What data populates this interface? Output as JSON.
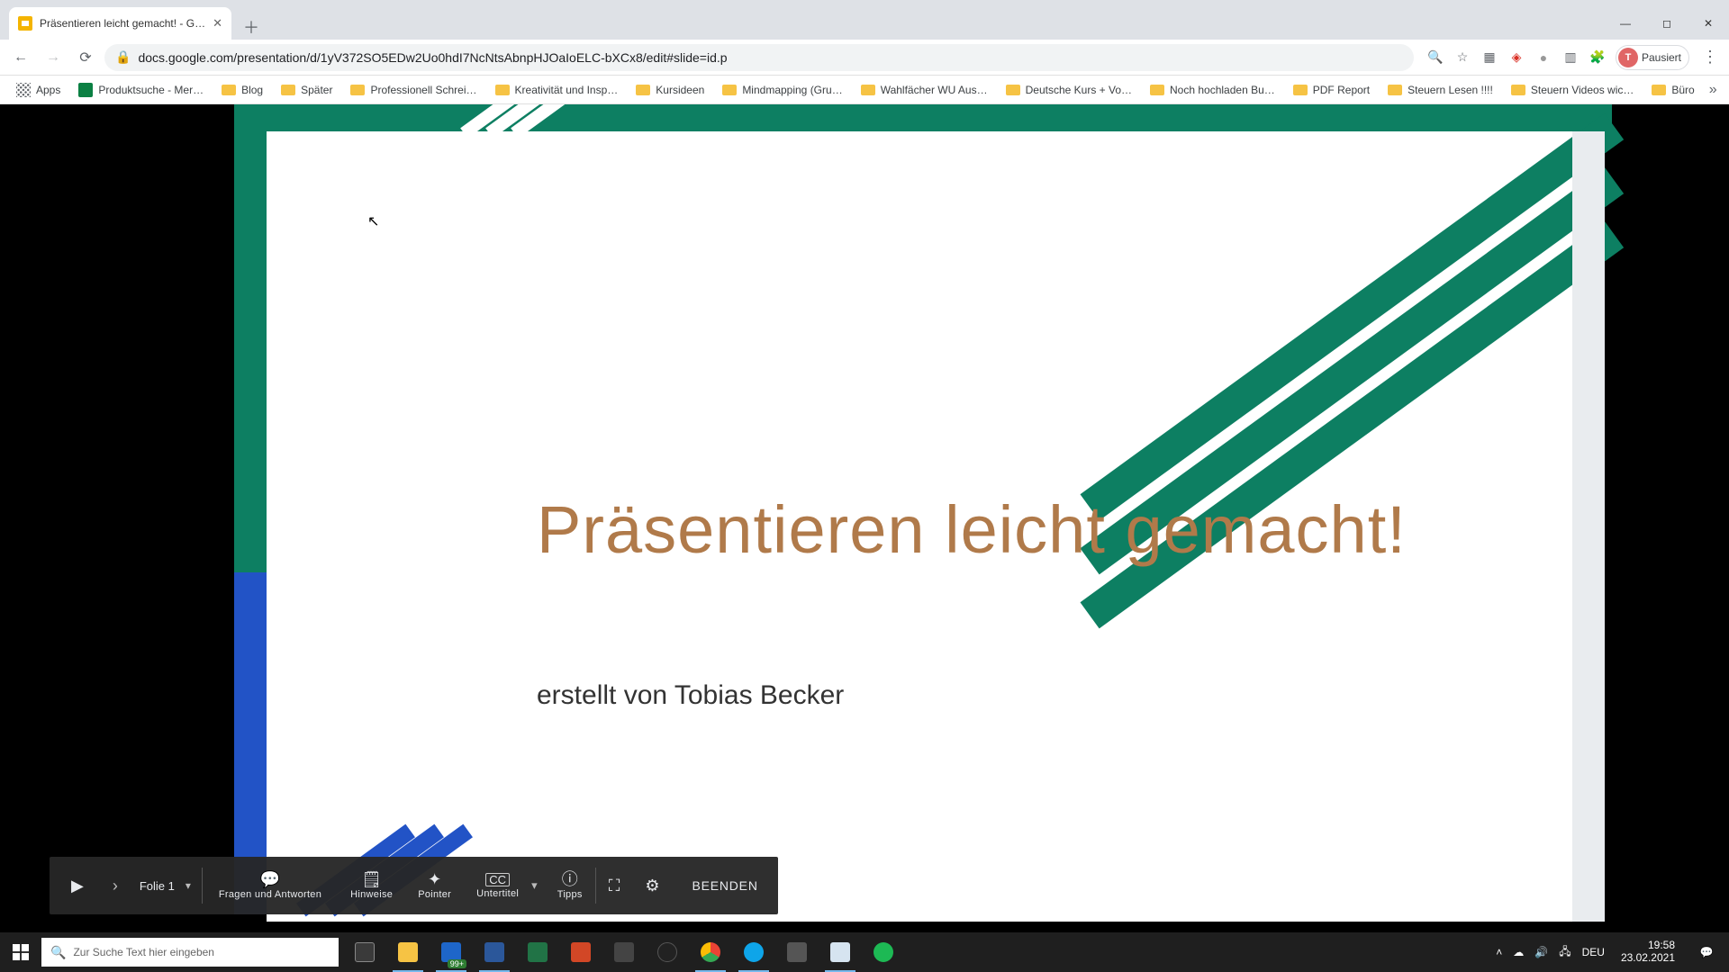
{
  "browser": {
    "tab_title": "Präsentieren leicht gemacht! - G…",
    "url": "docs.google.com/presentation/d/1yV372SO5EDw2Uo0hdI7NcNtsAbnpHJOaIoELC-bXCx8/edit#slide=id.p",
    "profile_state": "Pausiert",
    "profile_initial": "T",
    "apps_label": "Apps",
    "bookmarks": [
      {
        "label": "Produktsuche - Mer…",
        "icon": "img"
      },
      {
        "label": "Blog",
        "icon": "folder"
      },
      {
        "label": "Später",
        "icon": "folder"
      },
      {
        "label": "Professionell Schrei…",
        "icon": "folder"
      },
      {
        "label": "Kreativität und Insp…",
        "icon": "folder"
      },
      {
        "label": "Kursideen",
        "icon": "folder"
      },
      {
        "label": "Mindmapping  (Gru…",
        "icon": "folder"
      },
      {
        "label": "Wahlfächer WU Aus…",
        "icon": "folder"
      },
      {
        "label": "Deutsche Kurs + Vo…",
        "icon": "folder"
      },
      {
        "label": "Noch hochladen Bu…",
        "icon": "folder"
      },
      {
        "label": "PDF Report",
        "icon": "folder"
      },
      {
        "label": "Steuern Lesen !!!!",
        "icon": "folder"
      },
      {
        "label": "Steuern Videos wic…",
        "icon": "folder"
      },
      {
        "label": "Büro",
        "icon": "folder"
      }
    ]
  },
  "slide": {
    "title": "Präsentieren leicht gemacht!",
    "subtitle": "erstellt von Tobias Becker"
  },
  "presenter_bar": {
    "slide_label": "Folie 1",
    "qa": "Fragen und Antworten",
    "hints": "Hinweise",
    "pointer": "Pointer",
    "subtitles": "Untertitel",
    "tips": "Tipps",
    "end": "BEENDEN"
  },
  "taskbar": {
    "search_placeholder": "Zur Suche Text hier eingeben",
    "edge_badge": "99+",
    "lang": "DEU",
    "time": "19:58",
    "date": "23.02.2021"
  },
  "colors": {
    "teal": "#0d7f62",
    "blue": "#2253c6",
    "title": "#b07a4a"
  }
}
